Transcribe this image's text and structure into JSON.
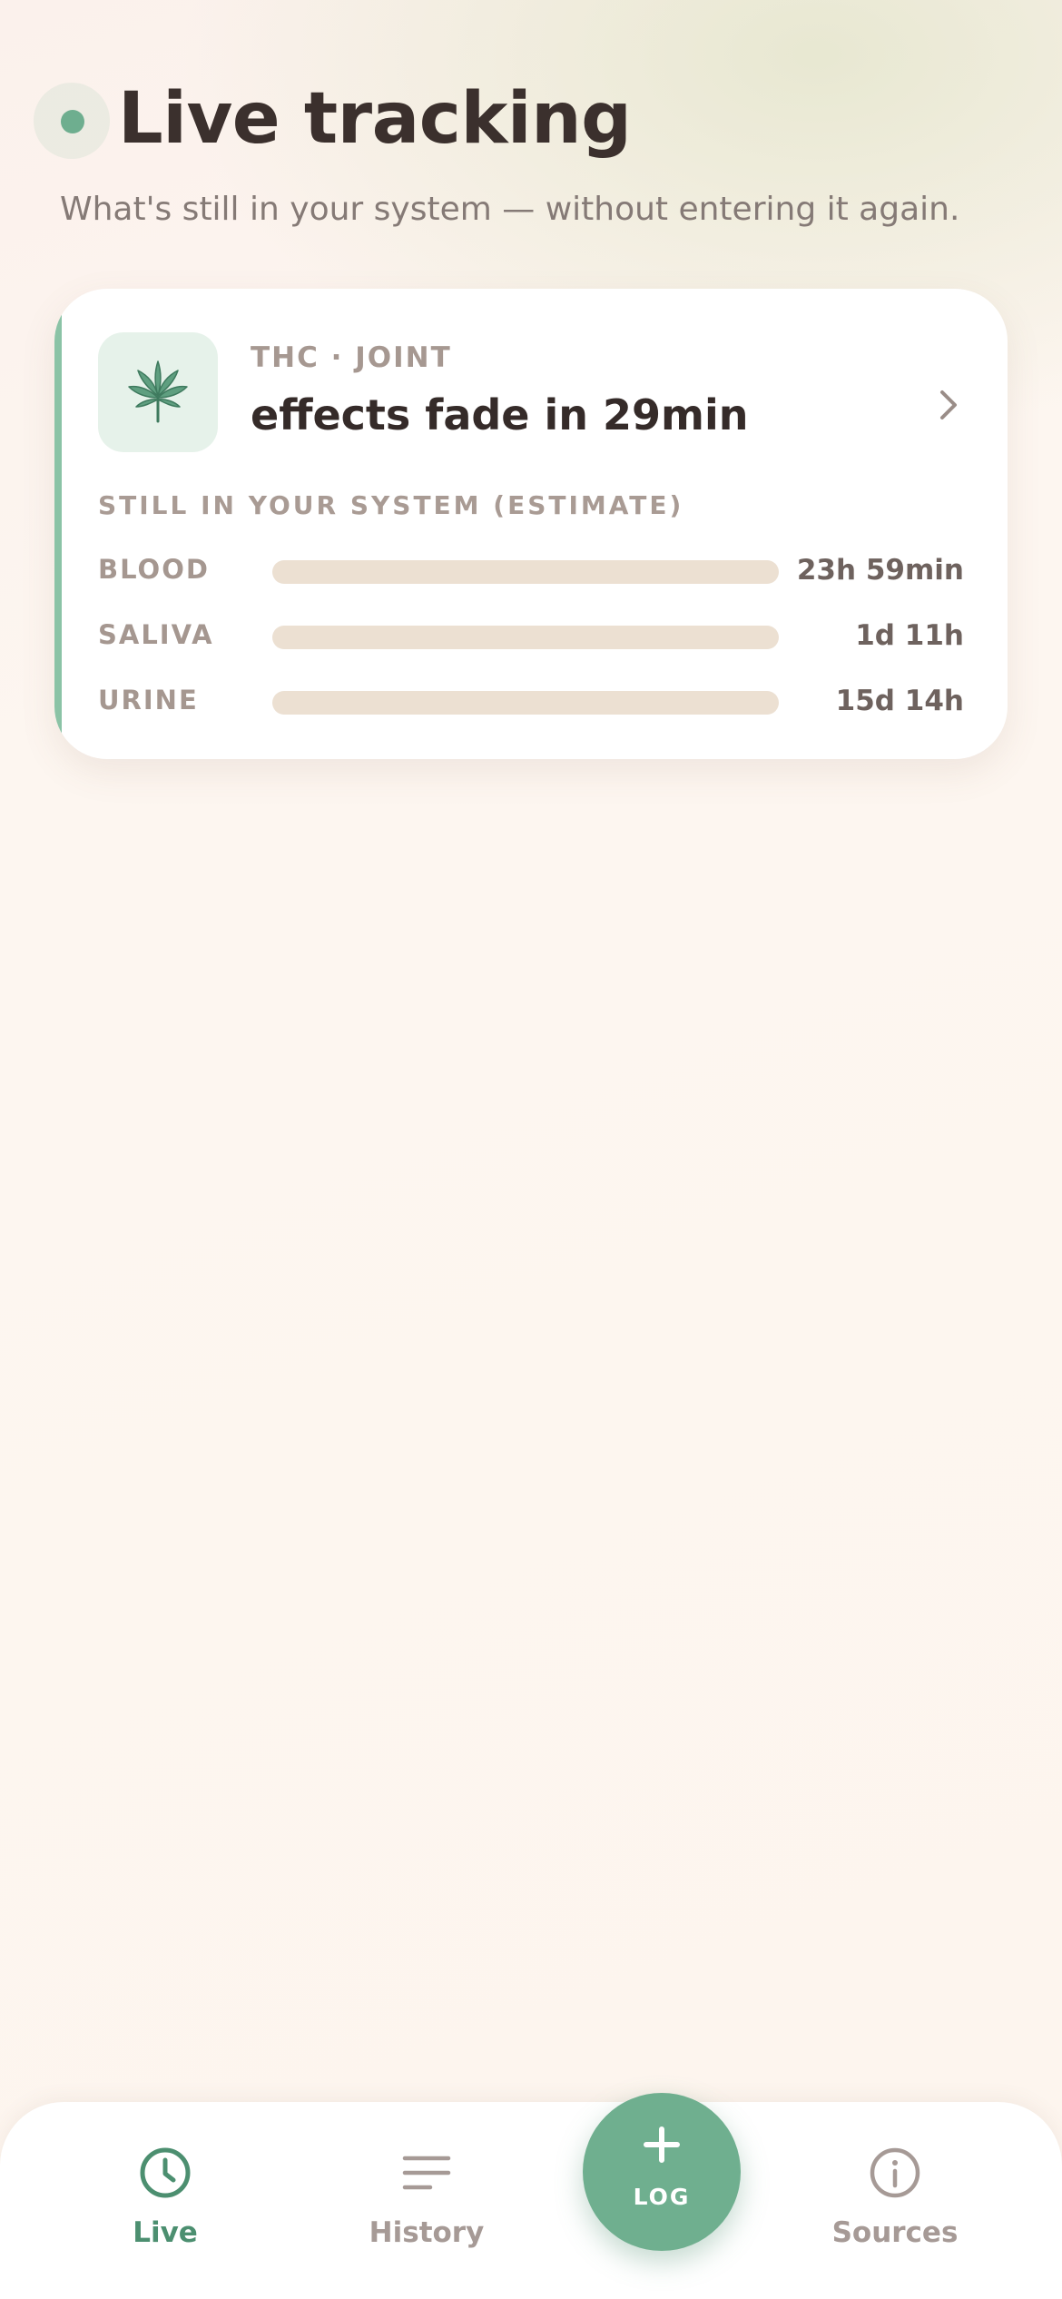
{
  "header": {
    "title": "Live tracking",
    "subtitle": "What's still in your system — without entering it again."
  },
  "card": {
    "icon": "cannabis-leaf-icon",
    "meta": "THC · JOINT",
    "headline": "effects fade in 29min",
    "section_label": "STILL IN YOUR SYSTEM (ESTIMATE)",
    "rows": [
      {
        "label": "BLOOD",
        "value": "23h 59min",
        "progress": 0
      },
      {
        "label": "SALIVA",
        "value": "1d 11h",
        "progress": 0
      },
      {
        "label": "URINE",
        "value": "15d 14h",
        "progress": 0
      }
    ]
  },
  "tabbar": {
    "tabs": [
      {
        "label": "Live",
        "icon": "clock-icon",
        "active": true
      },
      {
        "label": "History",
        "icon": "list-icon",
        "active": false
      },
      {
        "label": "Sources",
        "icon": "info-icon",
        "active": false
      }
    ],
    "fab_label": "LOG",
    "fab_icon": "plus-icon"
  },
  "colors": {
    "accent": "#6faf8f",
    "active_tab": "#4c8f70",
    "inactive_tab": "#a69a96",
    "track": "#ece0d2"
  }
}
